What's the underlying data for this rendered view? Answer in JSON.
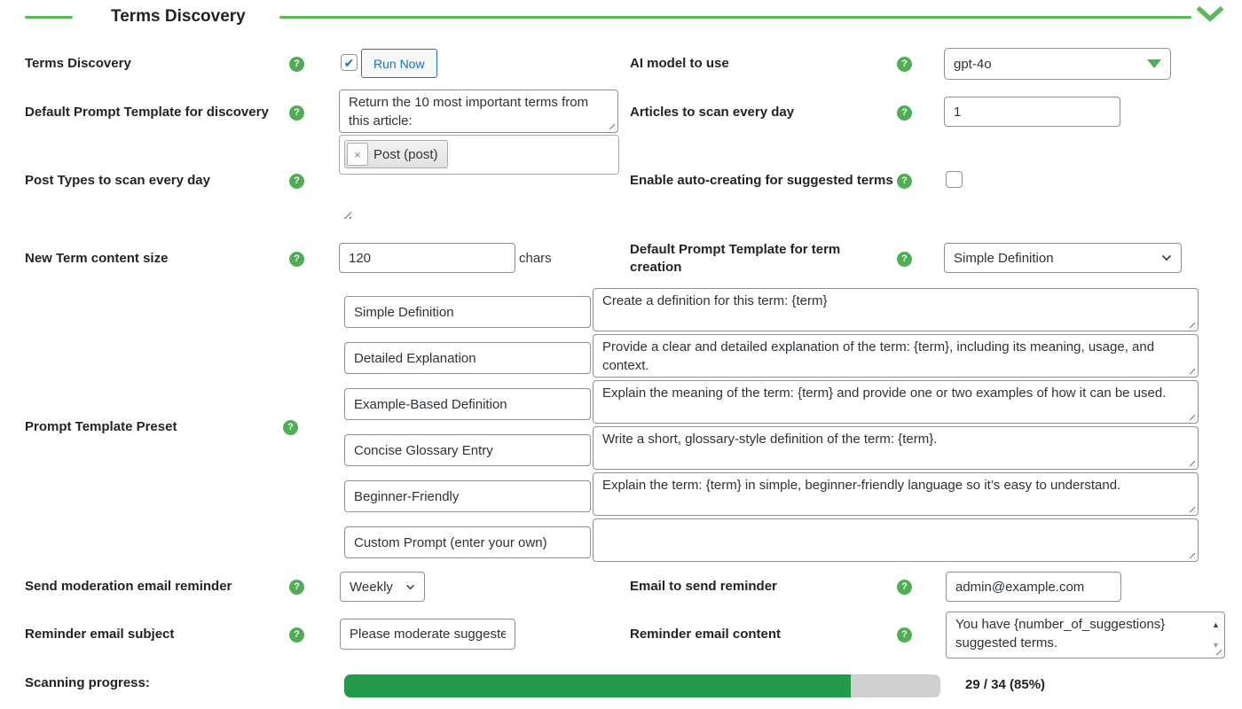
{
  "colors": {
    "accent_green": "#4fae55",
    "line_green": "#5cb85c",
    "progress_green": "#229a49",
    "progress_track": "#d0d0d0",
    "wp_blue": "#2271b1"
  },
  "icons": {
    "help": "?",
    "check": "✔",
    "remove": "×",
    "scroll_up": "▲",
    "scroll_down": "▼"
  },
  "header": {
    "title": "Terms Discovery"
  },
  "fields": {
    "terms_discovery": {
      "label": "Terms Discovery",
      "run_button": "Run Now",
      "checked": true
    },
    "ai_model": {
      "label": "AI model to use",
      "value": "gpt-4o"
    },
    "discovery_prompt": {
      "label": "Default Prompt Template for discovery",
      "value": "Return the 10 most important terms from this article:"
    },
    "articles_per_day": {
      "label": "Articles to scan every day",
      "value": "1"
    },
    "post_types": {
      "label": "Post Types to scan every day",
      "tag_label": "Post (post)"
    },
    "auto_create": {
      "label": "Enable auto-creating for suggested terms",
      "checked": false
    },
    "content_size": {
      "label": "New Term content size",
      "value": "120",
      "suffix": "chars"
    },
    "term_template": {
      "label": "Default Prompt Template for term creation",
      "value": "Simple Definition"
    },
    "preset": {
      "label": "Prompt Template Preset",
      "items": [
        {
          "name": "Simple Definition",
          "prompt": "Create a definition for this term: {term}"
        },
        {
          "name": "Detailed Explanation",
          "prompt": "Provide a clear and detailed explanation of the term: {term}, including its meaning, usage, and context."
        },
        {
          "name": "Example-Based Definition",
          "prompt": "Explain the meaning of the term: {term} and provide one or two examples of how it can be used."
        },
        {
          "name": "Concise Glossary Entry",
          "prompt": "Write a short, glossary-style definition of the term: {term}."
        },
        {
          "name": "Beginner-Friendly",
          "prompt": "Explain the term: {term} in simple, beginner-friendly language so it’s easy to understand."
        },
        {
          "name": "Custom Prompt (enter your own)",
          "prompt": ""
        }
      ]
    },
    "moderation_reminder": {
      "label": "Send moderation email reminder",
      "value": "Weekly"
    },
    "reminder_email": {
      "label": "Email to send reminder",
      "value": "admin@example.com"
    },
    "reminder_subject": {
      "label": "Reminder email subject",
      "value": "Please moderate suggeste"
    },
    "reminder_content": {
      "label": "Reminder email content",
      "value": "You have {number_of_suggestions} suggested terms."
    },
    "progress": {
      "label": "Scanning progress:",
      "display": "29 / 34 (85%)",
      "percent": 85,
      "current": 29,
      "total": 34
    }
  }
}
